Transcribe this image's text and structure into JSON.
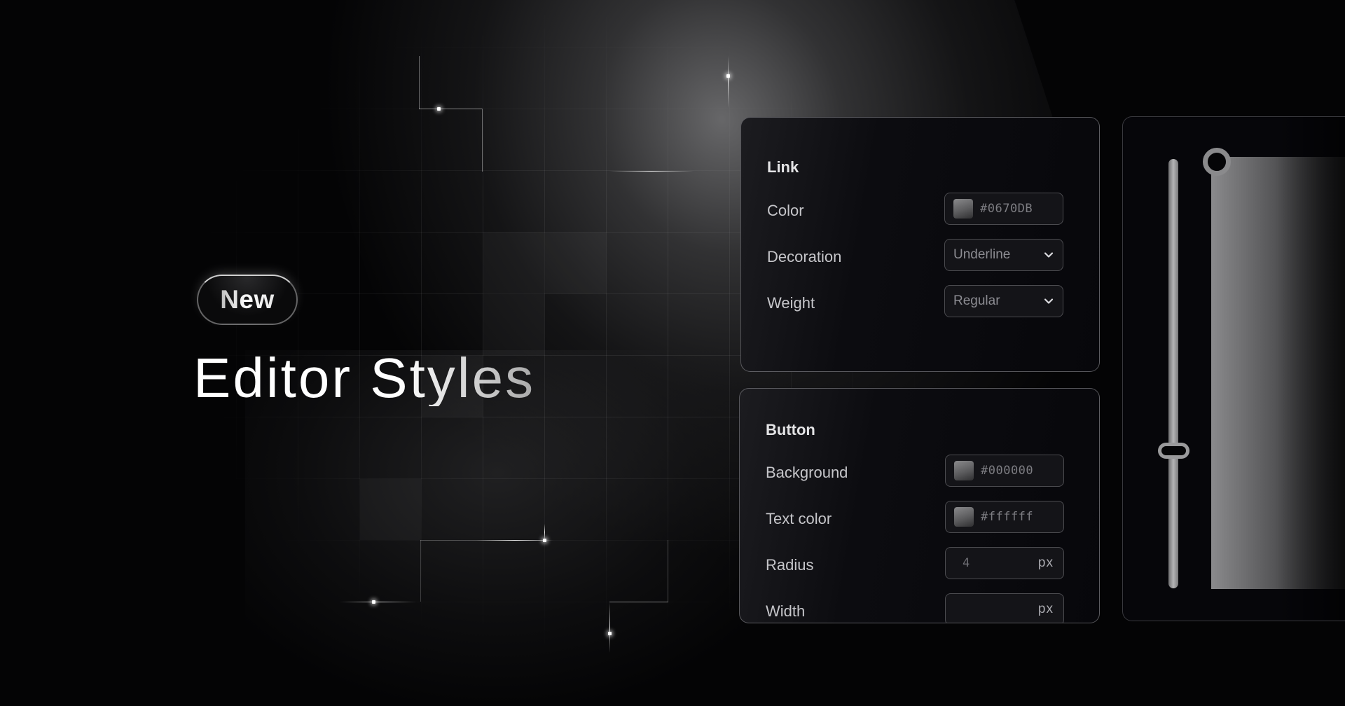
{
  "hero": {
    "badge_label": "New",
    "title": "Editor Styles"
  },
  "link_panel": {
    "title": "Link",
    "rows": [
      {
        "label": "Color",
        "type": "color",
        "value": "#0670DB"
      },
      {
        "label": "Decoration",
        "type": "select",
        "value": "Underline",
        "icon": "chevron-down-icon"
      },
      {
        "label": "Weight",
        "type": "select",
        "value": "Regular",
        "icon": "chevron-down-icon"
      }
    ]
  },
  "button_panel": {
    "title": "Button",
    "rows": [
      {
        "label": "Background",
        "type": "color",
        "value": "#000000"
      },
      {
        "label": "Text color",
        "type": "color",
        "value": "#ffffff"
      },
      {
        "label": "Radius",
        "type": "number",
        "value": "4",
        "unit": "px"
      },
      {
        "label": "Width",
        "type": "number",
        "value": "",
        "unit": "px"
      }
    ]
  },
  "preview_panel": {
    "slider_value_fraction": 0.68
  },
  "colors": {
    "background": "#040405",
    "panel": "#0c0c10",
    "text_primary": "#e4e4e6",
    "text_secondary": "#c6c6ca"
  }
}
